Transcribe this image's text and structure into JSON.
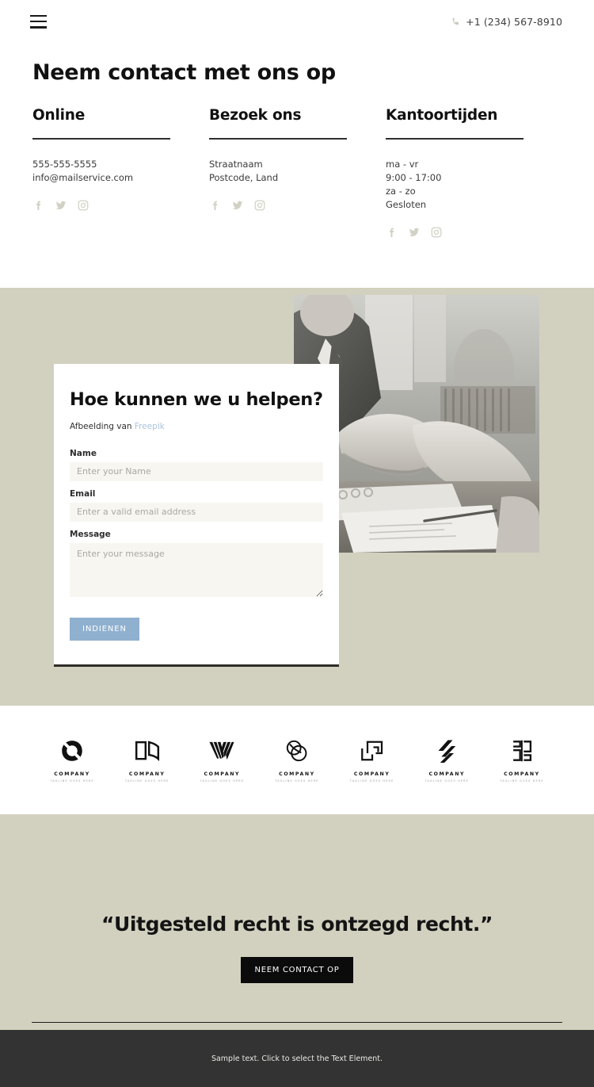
{
  "header": {
    "menu_icon": "hamburger-icon",
    "phone_icon": "phone-icon",
    "phone": "+1 (234) 567-8910"
  },
  "page_title": "Neem contact met ons op",
  "contact_columns": [
    {
      "heading": "Online",
      "lines": [
        "555-555-5555",
        "info@mailservice.com"
      ],
      "socials": [
        "facebook-icon",
        "twitter-icon",
        "instagram-icon"
      ]
    },
    {
      "heading": "Bezoek ons",
      "lines": [
        "Straatnaam",
        "Postcode, Land"
      ],
      "socials": [
        "facebook-icon",
        "twitter-icon",
        "instagram-icon"
      ]
    },
    {
      "heading": "Kantoortijden",
      "lines": [
        "ma - vr",
        "9:00 - 17:00",
        "za - zo",
        "Gesloten"
      ],
      "socials": [
        "facebook-icon",
        "twitter-icon",
        "instagram-icon"
      ]
    }
  ],
  "form": {
    "title": "Hoe kunnen we u helpen?",
    "credit_prefix": "Afbeelding van ",
    "credit_link": "Freepik",
    "fields": [
      {
        "label": "Name",
        "placeholder": "Enter your Name"
      },
      {
        "label": "Email",
        "placeholder": "Enter a valid email address"
      },
      {
        "label": "Message",
        "placeholder": "Enter your message"
      }
    ],
    "submit_label": "INDIENEN"
  },
  "photo": {
    "alt": "handshake-photo"
  },
  "logos": [
    {
      "mark": "circle-ring-logo-icon",
      "name": "COMPANY",
      "tagline": "TAGLINE GOES HERE"
    },
    {
      "mark": "open-book-logo-icon",
      "name": "COMPANY",
      "tagline": "TAGLINE GOES HERE"
    },
    {
      "mark": "v-stripes-logo-icon",
      "name": "COMPANY",
      "tagline": "TAGLINE GOES HERE"
    },
    {
      "mark": "overlapping-circles-logo-icon",
      "name": "COMPANY",
      "tagline": "TAGLINE GOES HERE"
    },
    {
      "mark": "squares-arrow-logo-icon",
      "name": "COMPANY",
      "tagline": "TAGLINE GOES HERE"
    },
    {
      "mark": "diagonal-slashes-logo-icon",
      "name": "COMPANY",
      "tagline": "TAGLINE GOES HERE"
    },
    {
      "mark": "split-blocks-logo-icon",
      "name": "COMPANY",
      "tagline": "TAGLINE GOES HERE"
    }
  ],
  "quote": {
    "text": "“Uitgesteld recht is ontzegd recht.”",
    "cta_label": "NEEM CONTACT OP"
  },
  "footer": {
    "text": "Sample text. Click to select the Text Element."
  },
  "colors": {
    "beige": "#d2d1c0",
    "white": "#ffffff",
    "dark": "#333333",
    "submit_blue": "#8fb0cf",
    "cta_black": "#0b0b0b",
    "input_fill": "#f7f6f1",
    "social_gray": "#d2d1c4",
    "link_blue": "#a8c4de"
  }
}
